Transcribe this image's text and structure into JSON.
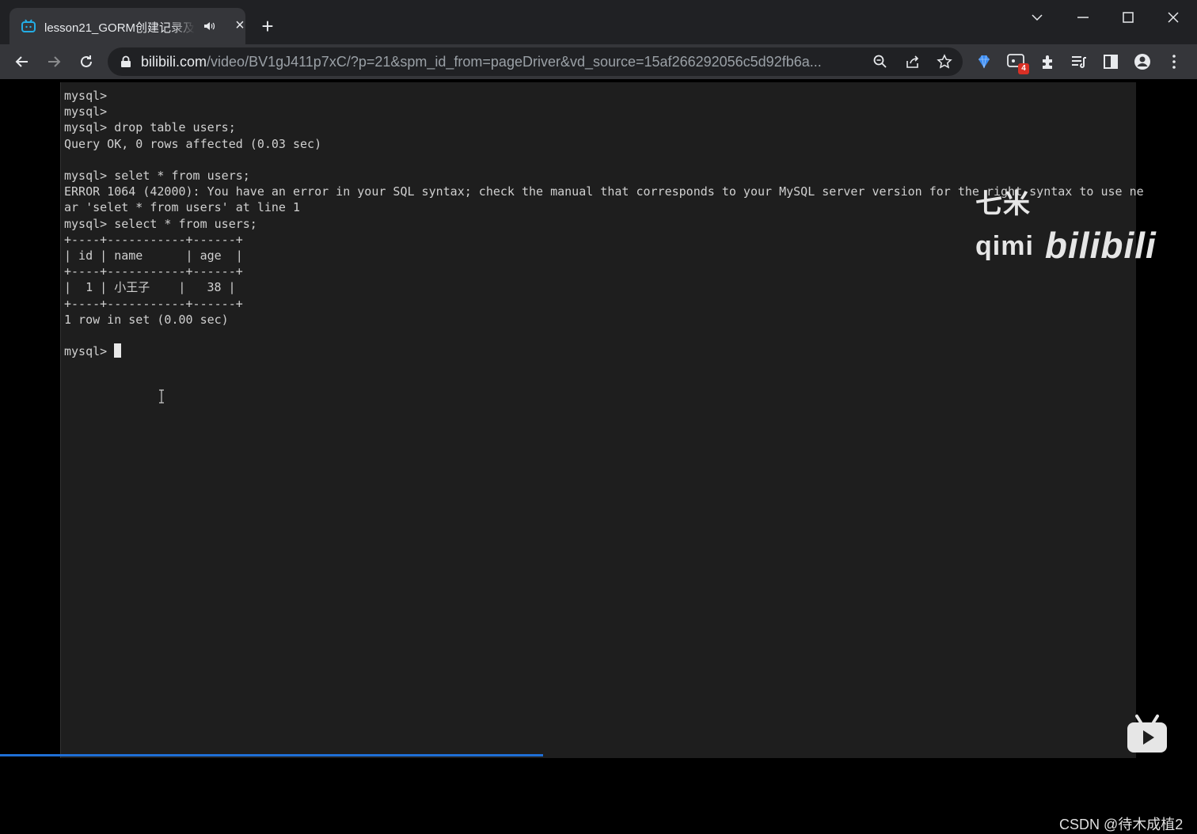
{
  "browser": {
    "tab": {
      "title": "lesson21_GORM创建记录及"
    },
    "url": {
      "host": "bilibili.com",
      "path": "/video/BV1gJ411p7xC/?p=21&spm_id_from=pageDriver&vd_source=15af266292056c5d92fb6a..."
    },
    "extension_badge": "4"
  },
  "terminal": {
    "lines": [
      "mysql>",
      "mysql>",
      "mysql> drop table users;",
      "Query OK, 0 rows affected (0.03 sec)",
      "",
      "mysql> selet * from users;",
      "ERROR 1064 (42000): You have an error in your SQL syntax; check the manual that corresponds to your MySQL server version for the right syntax to use ne",
      "ar 'selet * from users' at line 1",
      "mysql> select * from users;",
      "+----+-----------+------+",
      "| id | name      | age  |",
      "+----+-----------+------+",
      "|  1 | 小王子    |   38 |",
      "+----+-----------+------+",
      "1 row in set (0.00 sec)",
      ""
    ],
    "prompt": "mysql> "
  },
  "overlay": {
    "watermark_text": "七米qimi",
    "watermark_brand": "bilibili",
    "csdn_credit": "CSDN @待木成植2"
  },
  "colors": {
    "tab_strip": "#202124",
    "toolbar": "#35363a",
    "terminal_bg": "#1e1e1e",
    "terminal_text": "#d0d0d0",
    "progress": "#1f6fd6"
  }
}
